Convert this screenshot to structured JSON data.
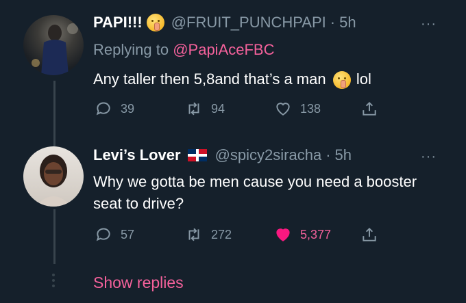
{
  "tweets": [
    {
      "display_name": "PAPI!!!",
      "handle": "@FRUIT_PUNCHPAPI",
      "dot": "·",
      "time": "5h",
      "replying_prefix": "Replying to",
      "replying_to": "@PapiAceFBC",
      "text_before": "Any taller then 5,8and that’s a man",
      "text_after": "lol",
      "replies": "39",
      "retweets": "94",
      "likes": "138",
      "more": "···"
    },
    {
      "display_name": "Levi’s Lover",
      "handle": "@spicy2siracha",
      "dot": "·",
      "time": "5h",
      "text": "Why we gotta be men cause you need a booster seat to drive?",
      "replies": "57",
      "retweets": "272",
      "likes": "5,377",
      "liked": true,
      "more": "···"
    }
  ],
  "show_replies": "Show replies",
  "colors": {
    "background": "#15202b",
    "secondary_text": "#8899a6",
    "accent_pink": "#f4619b",
    "like_red": "#f91880"
  },
  "icons": [
    "reply-icon",
    "retweet-icon",
    "heart-icon",
    "share-icon",
    "more-icon",
    "shushing-face-emoji",
    "dominican-flag-emoji"
  ]
}
